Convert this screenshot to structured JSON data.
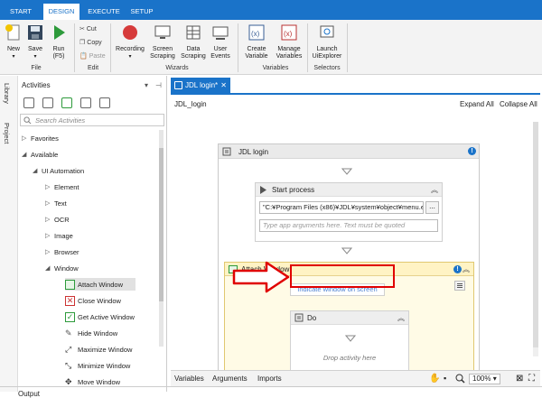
{
  "tabs": [
    "START",
    "DESIGN",
    "EXECUTE",
    "SETUP"
  ],
  "ribbon": {
    "new_label": "New",
    "save_label": "Save",
    "run_label": "Run",
    "run_sub": "(F5)",
    "cut": "Cut",
    "copy": "Copy",
    "paste": "Paste",
    "recording": "Recording",
    "screen_scraping_1": "Screen",
    "screen_scraping_2": "Scraping",
    "data_scraping_1": "Data",
    "data_scraping_2": "Scraping",
    "user_events_1": "User",
    "user_events_2": "Events",
    "create_var_1": "Create",
    "create_var_2": "Variable",
    "manage_var_1": "Manage",
    "manage_var_2": "Variables",
    "launch_1": "Launch",
    "launch_2": "UiExplorer",
    "groups": {
      "file": "File",
      "edit": "Edit",
      "wizards": "Wizards",
      "variables": "Variables",
      "selectors": "Selectors"
    }
  },
  "side_tabs": {
    "library": "Library",
    "project": "Project"
  },
  "activities": {
    "title": "Activities",
    "search_placeholder": "Search Activities",
    "tree": {
      "favorites": "Favorites",
      "available": "Available",
      "ui_automation": "UI Automation",
      "element": "Element",
      "text": "Text",
      "ocr": "OCR",
      "image": "Image",
      "browser": "Browser",
      "window": "Window",
      "attach_window": "Attach Window",
      "close_window": "Close Window",
      "get_active_window": "Get Active Window",
      "hide_window": "Hide Window",
      "maximize_window": "Maximize Window",
      "minimize_window": "Minimize Window",
      "move_window": "Move Window"
    }
  },
  "output_label": "Output",
  "designer": {
    "tab_label": "JDL login*",
    "breadcrumb": "JDL_login",
    "expand_all": "Expand All",
    "collapse_all": "Collapse All",
    "sequence_title": "JDL login",
    "start_process": {
      "title": "Start process",
      "path": "\"C:¥Program Files (x86)¥JDL¥system¥object¥menu.exe\"",
      "args_placeholder": "Type app arguments here. Text must be quoted"
    },
    "attach_window": {
      "title": "Attach Window",
      "indicate": "Indicate window on screen"
    },
    "do": {
      "title": "Do",
      "drop": "Drop activity here"
    }
  },
  "footer": {
    "variables": "Variables",
    "arguments": "Arguments",
    "imports": "Imports",
    "zoom": "100%"
  },
  "colors": {
    "accent": "#1a73c9",
    "annotation": "#e00000",
    "attach_bg": "#fffbe6"
  }
}
